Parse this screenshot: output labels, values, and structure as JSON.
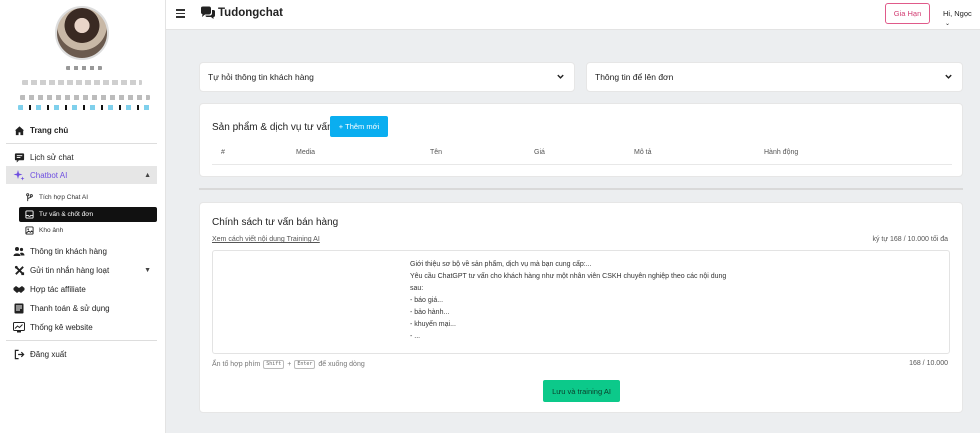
{
  "header": {
    "brand": "Tudongchat",
    "renew_label": "Gia Hạn",
    "greeting": "Hi, Ngọc"
  },
  "sidebar": {
    "items": [
      {
        "label": "Trang chủ",
        "icon": "home-icon"
      },
      {
        "label": "Lịch sử chat",
        "icon": "chat-history-icon"
      },
      {
        "label": "Chatbot AI",
        "icon": "sparkle-icon"
      },
      {
        "label": "Thông tin khách hàng",
        "icon": "users-icon"
      },
      {
        "label": "Gửi tin nhắn hàng loạt",
        "icon": "tools-icon"
      },
      {
        "label": "Hợp tác affiliate",
        "icon": "handshake-icon"
      },
      {
        "label": "Thanh toán & sử dụng",
        "icon": "billing-icon"
      },
      {
        "label": "Thống kê website",
        "icon": "analytics-icon"
      },
      {
        "label": "Đăng xuất",
        "icon": "logout-icon"
      }
    ],
    "sub_items": [
      {
        "label": "Tích hợp Chat AI",
        "icon": "branch-icon"
      },
      {
        "label": "Tư vấn & chốt đơn",
        "icon": "inbox-icon"
      },
      {
        "label": "Kho ảnh",
        "icon": "image-icon"
      }
    ]
  },
  "dropdowns": {
    "left": "Tự hỏi thông tin khách hàng",
    "right": "Thông tin để lên đơn"
  },
  "products": {
    "title": "Sản phẩm & dịch vụ tư vấn",
    "add_label": "+ Thêm mới",
    "columns": [
      "#",
      "Media",
      "Tên",
      "Giá",
      "Mô tả",
      "Hành động"
    ]
  },
  "policy": {
    "title": "Chính sách tư vấn bán hàng",
    "guide_link": "Xem cách viết nội dung Training AI",
    "char_counter": "ký tự 168 / 10.000 tối đa",
    "content_lines": [
      "Giới thiệu sơ bộ về sản phẩm, dịch vụ mà bạn cung cấp:...",
      "Yêu cầu ChatGPT tư vấn cho khách hàng như một nhân viên CSKH chuyên nghiệp theo các nội dung",
      "sau:",
      "- báo giá...",
      "- bảo hành...",
      "- khuyến mại...",
      "- ..."
    ],
    "hint_prefix": "Ấn tổ hợp phím",
    "key_shift": "Shift",
    "hint_plus": "+",
    "key_enter": "Enter",
    "hint_suffix": "để xuống dòng",
    "bottom_counter": "168 / 10.000",
    "save_label": "Lưu và training AI"
  },
  "colors": {
    "accent_blue": "#0aaef0",
    "save_green": "#0cc98a",
    "renew_pink": "#d23c72",
    "chatbot_purple": "#6f4fe0"
  }
}
